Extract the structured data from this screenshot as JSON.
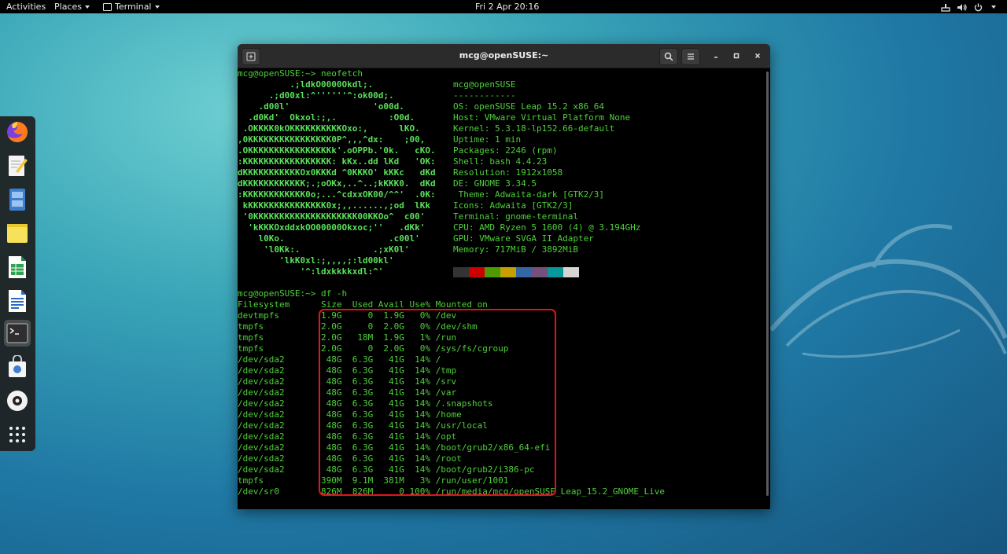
{
  "topbar": {
    "activities": "Activities",
    "places": "Places",
    "app_menu": "Terminal",
    "clock": "Fri 2 Apr  20:16"
  },
  "dock": {
    "items": [
      {
        "name": "firefox",
        "icon": "firefox-icon"
      },
      {
        "name": "text-editor",
        "icon": "text-editor-icon"
      },
      {
        "name": "files",
        "icon": "files-icon"
      },
      {
        "name": "notes",
        "icon": "notes-icon"
      },
      {
        "name": "calc",
        "icon": "spreadsheet-icon"
      },
      {
        "name": "writer",
        "icon": "document-icon"
      },
      {
        "name": "terminal",
        "icon": "terminal-icon"
      },
      {
        "name": "software",
        "icon": "software-store-icon"
      },
      {
        "name": "disks",
        "icon": "disc-icon"
      },
      {
        "name": "app-grid",
        "icon": "app-grid-icon"
      }
    ]
  },
  "window": {
    "title": "mcg@openSUSE:~"
  },
  "terminal": {
    "prompt1": "mcg@openSUSE:~> neofetch",
    "logo": [
      "          .;ldkO0000Okdl;.",
      "      .;d00xl:^''''''^:ok00d;.",
      "    .d00l'                'o00d.",
      "  .d0Kd'  Okxol:;,.          :O0d.",
      " .OKKKK0kOKKKKKKKKKKOxo:,      lKO.",
      ",0KKKKKKKKKKKKKKKK0P^,,,^dx:    ;00,",
      ".OKKKKKKKKKKKKKKKKk'.oOPPb.'0k.   cKO.",
      ":KKKKKKKKKKKKKKKKK: kKx..dd lKd   'OK:",
      "dKKKKKKKKKKKOx0KKKd ^0KKKO' kKKc   dKd",
      "dKKKKKKKKKKKK;.;oOKx,..^..;kKKK0.  dKd",
      ":KKKKKKKKKKKK0o;...^cdxxOK00/^^'  .0K:",
      " kKKKKKKKKKKKKKKK0x;,,......,;od  lKk",
      " '0KKKKKKKKKKKKKKKKKKKK00KKOo^  c00'",
      "  'kKKKOxddxkOO00000Okxoc;''   .dKk'",
      "    l0Ko.                    .c00l'",
      "     'l0Kk:.              .;xK0l'",
      "        'lkK0xl:;,,,,;:ld00kl'",
      "            '^:ldxkkkkxdl:^'"
    ],
    "info": [
      "mcg@openSUSE",
      "------------",
      "OS: openSUSE Leap 15.2 x86_64",
      "Host: VMware Virtual Platform None",
      "Kernel: 5.3.18-lp152.66-default",
      "Uptime: 1 min",
      "Packages: 2246 (rpm)",
      "Shell: bash 4.4.23",
      "Resolution: 1912x1058",
      "DE: GNOME 3.34.5",
      " Theme: Adwaita-dark [GTK2/3]",
      "Icons: Adwaita [GTK2/3]",
      "Terminal: gnome-terminal",
      "CPU: AMD Ryzen 5 1600 (4) @ 3.194GHz",
      "GPU: VMware SVGA II Adapter",
      "Memory: 717MiB / 3892MiB"
    ],
    "palette": [
      "#333333",
      "#cc0000",
      "#4e9a06",
      "#c4a000",
      "#3465a4",
      "#75507b",
      "#06989a",
      "#d3d7cf"
    ],
    "prompt2": "mcg@openSUSE:~> df -h",
    "df_lines": [
      "Filesystem      Size  Used Avail Use% Mounted on",
      "devtmpfs        1.9G     0  1.9G   0% /dev",
      "tmpfs           2.0G     0  2.0G   0% /dev/shm",
      "tmpfs           2.0G   18M  1.9G   1% /run",
      "tmpfs           2.0G     0  2.0G   0% /sys/fs/cgroup",
      "/dev/sda2        48G  6.3G   41G  14% /",
      "/dev/sda2        48G  6.3G   41G  14% /tmp",
      "/dev/sda2        48G  6.3G   41G  14% /srv",
      "/dev/sda2        48G  6.3G   41G  14% /var",
      "/dev/sda2        48G  6.3G   41G  14% /.snapshots",
      "/dev/sda2        48G  6.3G   41G  14% /home",
      "/dev/sda2        48G  6.3G   41G  14% /usr/local",
      "/dev/sda2        48G  6.3G   41G  14% /opt",
      "/dev/sda2        48G  6.3G   41G  14% /boot/grub2/x86_64-efi",
      "/dev/sda2        48G  6.3G   41G  14% /root",
      "/dev/sda2        48G  6.3G   41G  14% /boot/grub2/i386-pc",
      "tmpfs           390M  9.1M  381M   3% /run/user/1001",
      "/dev/sr0        826M  826M     0 100% /run/media/mcg/openSUSE_Leap_15.2_GNOME_Live"
    ]
  }
}
